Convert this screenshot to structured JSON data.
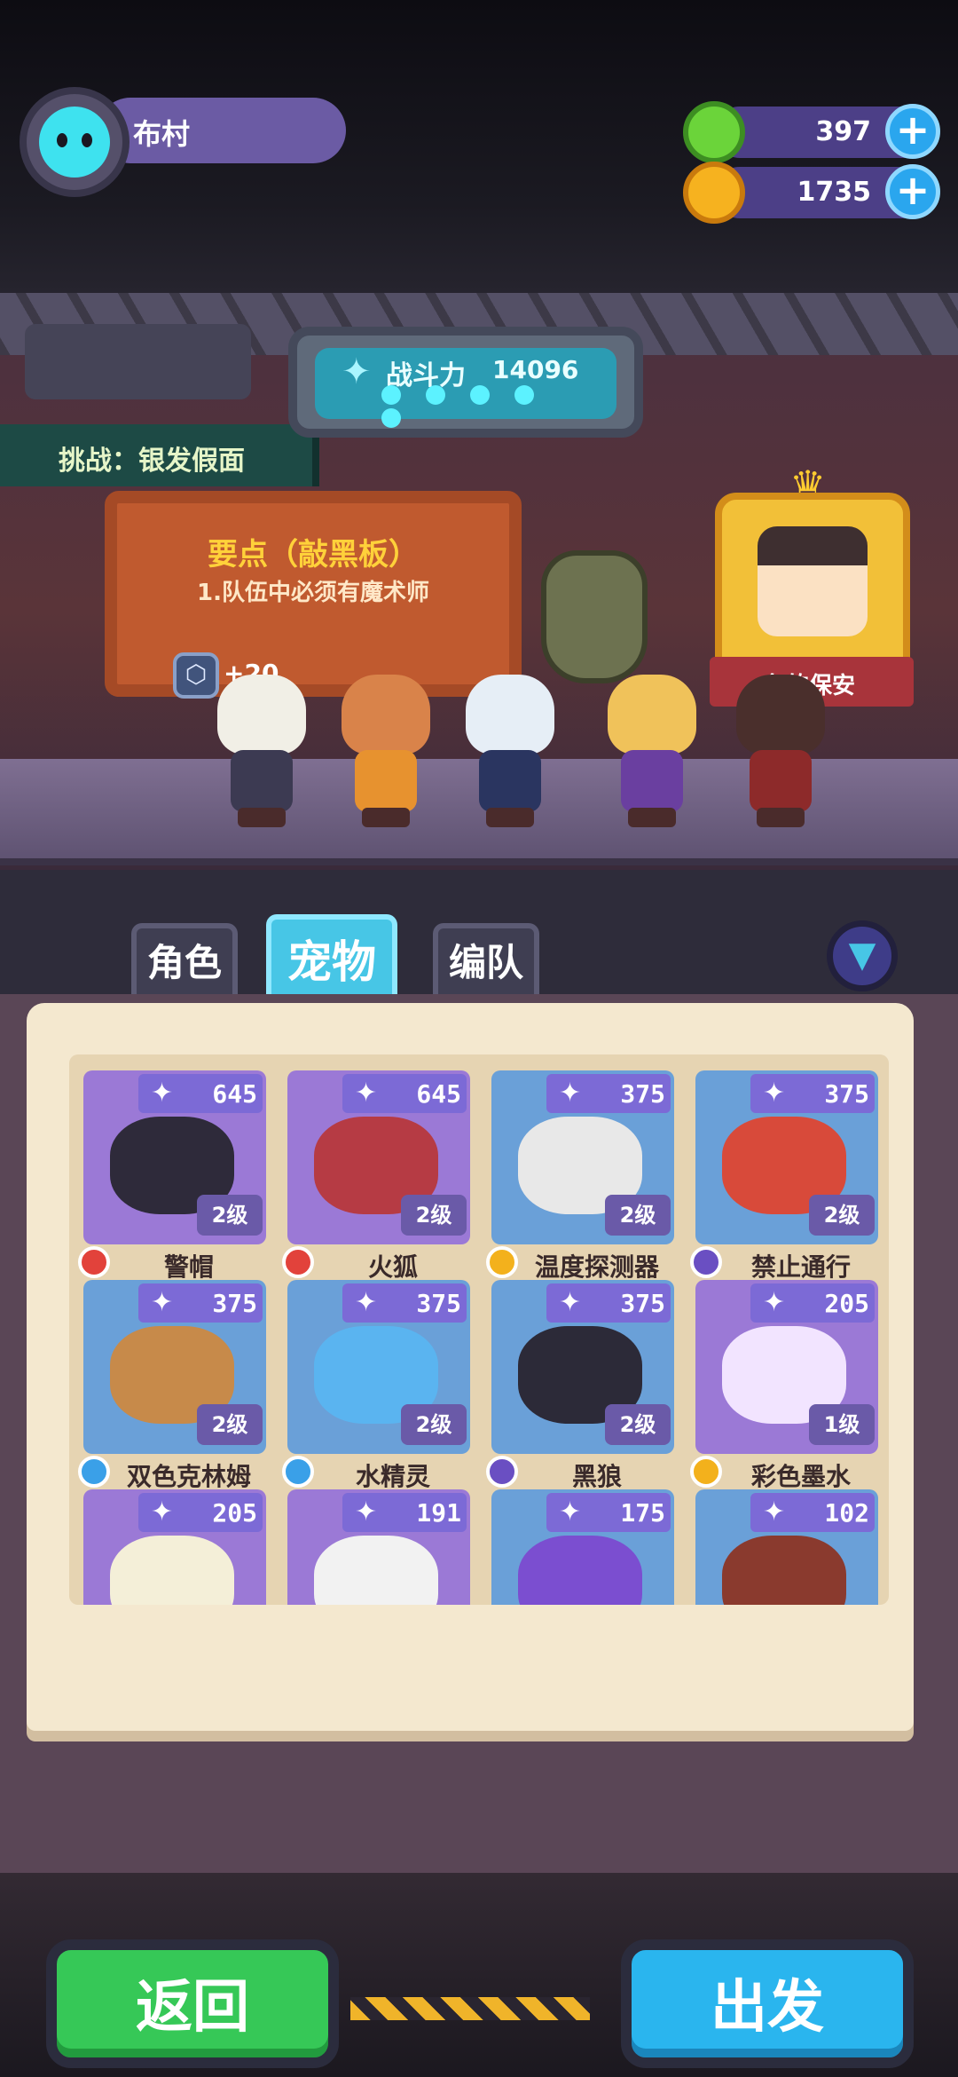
{
  "player": {
    "name": "布村"
  },
  "resources": [
    {
      "name": "gems",
      "value": "397",
      "icon": "gem-icon",
      "color": "#6bd43a"
    },
    {
      "name": "coins",
      "value": "1735",
      "icon": "coin-icon",
      "color": "#f6b21f"
    }
  ],
  "challenge": {
    "text": "挑战：银发假面"
  },
  "power": {
    "label": "战斗力",
    "value": "14096"
  },
  "board": {
    "title": "要点（敲黑板）",
    "rule": "1.队伍中必须有魔术师"
  },
  "guard_banner": "务的保安",
  "bonus": "+20",
  "tabs": {
    "role": "角色",
    "pet": "宠物",
    "team": "编队"
  },
  "pets": [
    {
      "value": "645",
      "level": "2级",
      "name": "警帽",
      "element": "fire",
      "bg": "#9b79d6",
      "color": "#2e2a3a"
    },
    {
      "value": "645",
      "level": "2级",
      "name": "火狐",
      "element": "fire",
      "bg": "#9b79d6",
      "color": "#b63b44"
    },
    {
      "value": "375",
      "level": "2级",
      "name": "温度探测器",
      "element": "light",
      "bg": "#6aa0d8",
      "color": "#e8e8e8"
    },
    {
      "value": "375",
      "level": "2级",
      "name": "禁止通行",
      "element": "dark",
      "bg": "#6aa0d8",
      "color": "#d84a3a"
    },
    {
      "value": "375",
      "level": "2级",
      "name": "双色克林姆",
      "element": "water",
      "bg": "#6aa0d8",
      "color": "#c78a4a"
    },
    {
      "value": "375",
      "level": "2级",
      "name": "水精灵",
      "element": "water",
      "bg": "#6aa0d8",
      "color": "#5ab4f0"
    },
    {
      "value": "375",
      "level": "2级",
      "name": "黑狼",
      "element": "dark",
      "bg": "#6aa0d8",
      "color": "#2c2a38"
    },
    {
      "value": "205",
      "level": "1级",
      "name": "彩色墨水",
      "element": "light",
      "bg": "#9b79d6",
      "color": "#f2e4ff"
    },
    {
      "value": "205",
      "level": "",
      "name": "",
      "element": "",
      "bg": "#9b79d6",
      "color": "#f4efd8"
    },
    {
      "value": "191",
      "level": "",
      "name": "",
      "element": "",
      "bg": "#9b79d6",
      "color": "#f2f2f2"
    },
    {
      "value": "175",
      "level": "",
      "name": "",
      "element": "",
      "bg": "#6aa0d8",
      "color": "#7b4ed0"
    },
    {
      "value": "102",
      "level": "",
      "name": "",
      "element": "",
      "bg": "#6aa0d8",
      "color": "#8a3a2e"
    }
  ],
  "element_colors": {
    "fire": "#e2423b",
    "light": "#f3b11c",
    "dark": "#6a4fc2",
    "water": "#3aa0e8"
  },
  "buttons": {
    "back": "返回",
    "go": "出发"
  }
}
